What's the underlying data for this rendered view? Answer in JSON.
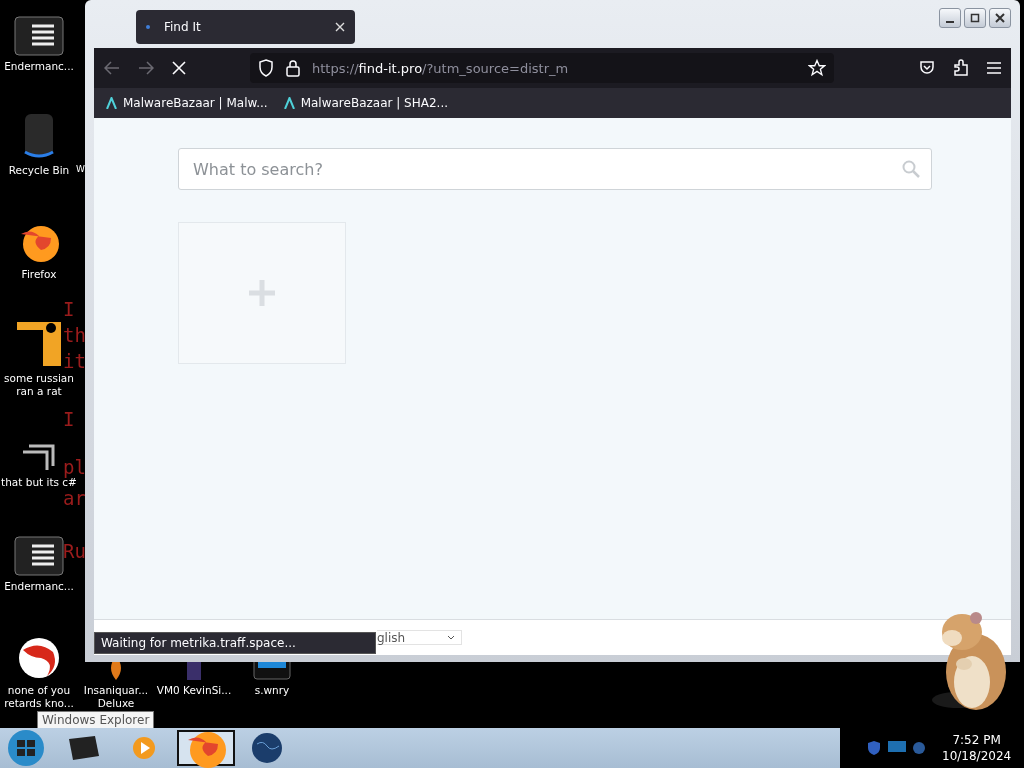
{
  "desktop_icons": [
    {
      "label": "Endermanc...",
      "kind": "notepad"
    },
    {
      "label": "Recycle Bin",
      "kind": "bin"
    },
    {
      "label": "Firefox",
      "kind": "firefox"
    },
    {
      "label": "some russian ran a rat",
      "kind": "java"
    },
    {
      "label": "that but its c#",
      "kind": "shortcut"
    },
    {
      "label": "Endermanc...",
      "kind": "notepad"
    },
    {
      "label": "none of you retards kno...",
      "kind": "swirl"
    }
  ],
  "hidden_icon_label": "W",
  "background_text": [
    "I",
    "th",
    "it",
    "I",
    "pl",
    "ar",
    "Ru"
  ],
  "bottom_icons": [
    {
      "label": "Insaniquar... Deluxe",
      "kind": "flame"
    },
    {
      "label": "VM0 KevinSi...",
      "kind": "box"
    },
    {
      "label": "s.wnry",
      "kind": "screen"
    }
  ],
  "browser": {
    "tabs": [
      {
        "title": "Find It",
        "selected": true
      }
    ],
    "url": {
      "scheme": "https://",
      "host": "find-it.pro",
      "rest": "/?utm_source=distr_m"
    },
    "bookmarks": [
      {
        "label": "MalwareBazaar | Malw..."
      },
      {
        "label": "MalwareBazaar | SHA2..."
      }
    ],
    "search": {
      "placeholder": "What to search?"
    },
    "language_select": {
      "value": "glish"
    },
    "status": "Waiting for metrika.traff.space..."
  },
  "tooltip": "Windows Explorer",
  "taskbar": {
    "items": [
      {
        "kind": "explorer",
        "selected": false
      },
      {
        "kind": "media",
        "selected": false
      },
      {
        "kind": "firefox",
        "selected": true
      },
      {
        "kind": "globe",
        "selected": false
      }
    ],
    "time": "7:52 PM",
    "date": "10/18/2024"
  }
}
